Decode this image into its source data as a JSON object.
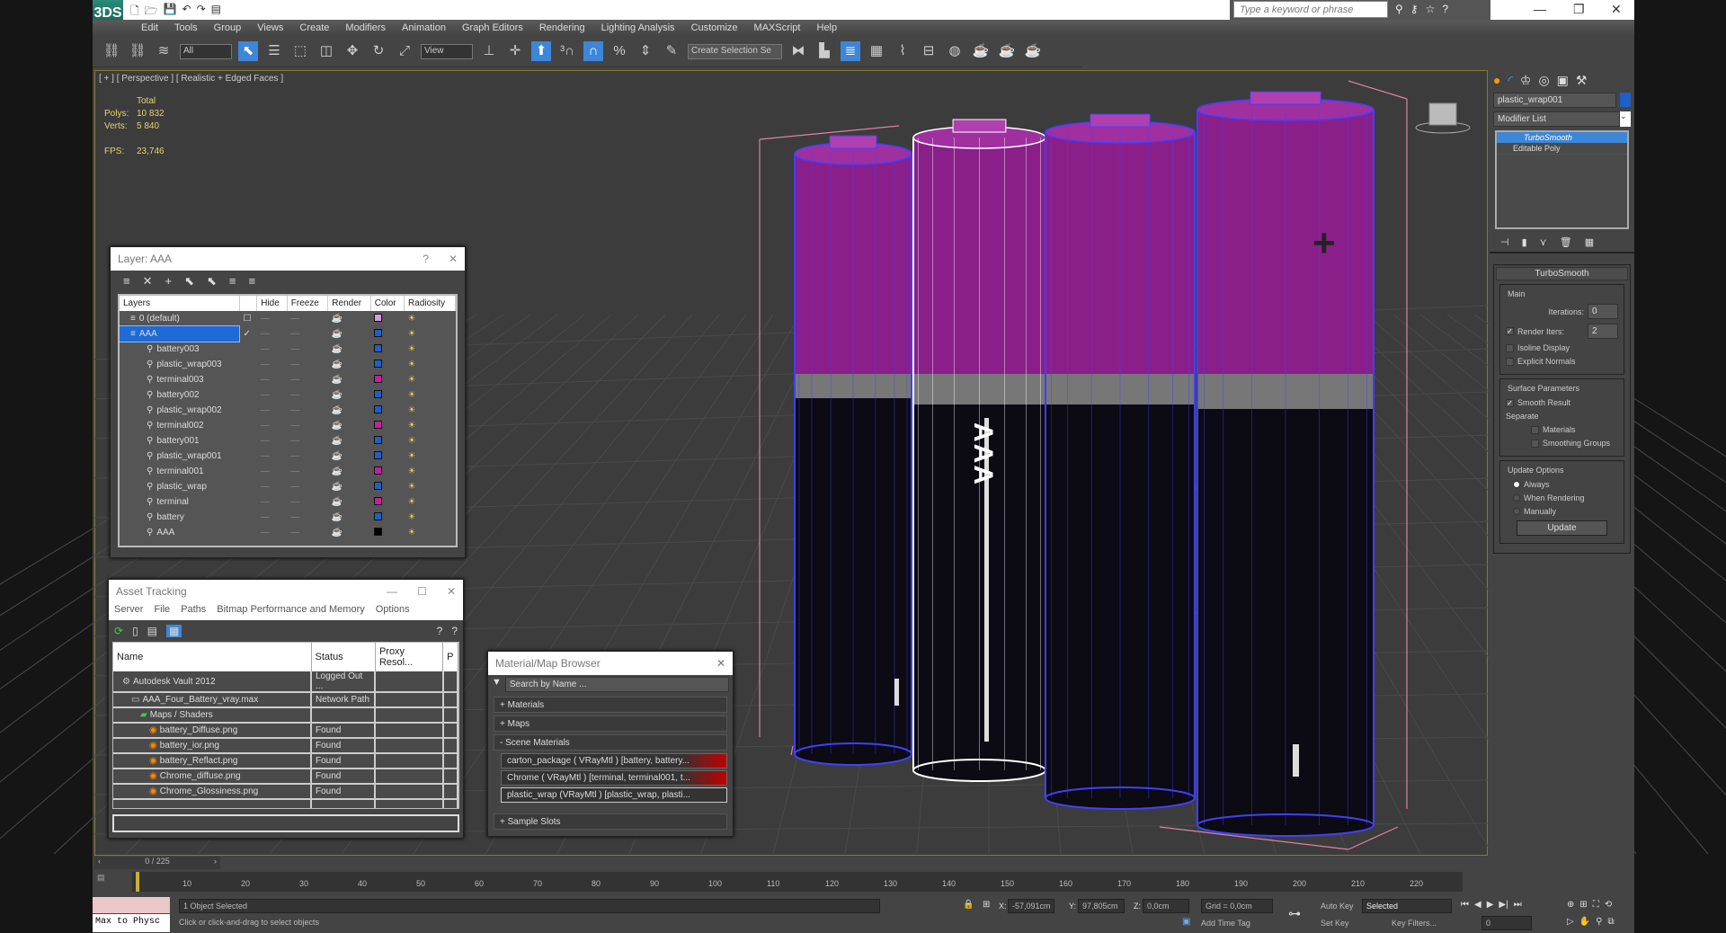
{
  "titlebar": {
    "search_placeholder": "Type a keyword or phrase",
    "logo": "3DS",
    "minimize": "—",
    "restore": "❐",
    "close": "✕"
  },
  "menu": [
    "Edit",
    "Tools",
    "Group",
    "Views",
    "Create",
    "Modifiers",
    "Animation",
    "Graph Editors",
    "Rendering",
    "Lighting Analysis",
    "Customize",
    "MAXScript",
    "Help"
  ],
  "toolbar": {
    "filter": "All",
    "ref_coord": "View",
    "selection_set": "Create Selection Se"
  },
  "viewport": {
    "label": "[ + ] [ Perspective ] [ Realistic + Edged Faces ]",
    "total_label": "Total",
    "polys_label": "Polys:",
    "polys": "10 832",
    "verts_label": "Verts:",
    "verts": "5 840",
    "fps_label": "FPS:",
    "fps": "23,746",
    "battery_text": "AAA"
  },
  "layer_dialog": {
    "title": "Layer: AAA",
    "help": "?",
    "close": "✕",
    "columns": [
      "Layers",
      "",
      "Hide",
      "Freeze",
      "Render",
      "Color",
      "Radiosity"
    ],
    "rows": [
      {
        "name": "0 (default)",
        "color": "#d79be0",
        "level": 0,
        "check": "☐"
      },
      {
        "name": "AAA",
        "color": "#1e5fc8",
        "level": 0,
        "check": "✓",
        "selected": true
      },
      {
        "name": "battery003",
        "color": "#1e5fc8",
        "level": 1
      },
      {
        "name": "plastic_wrap003",
        "color": "#1e5fc8",
        "level": 1
      },
      {
        "name": "terminal003",
        "color": "#c81ea0",
        "level": 1
      },
      {
        "name": "battery002",
        "color": "#1e5fc8",
        "level": 1
      },
      {
        "name": "plastic_wrap002",
        "color": "#1e5fc8",
        "level": 1
      },
      {
        "name": "terminal002",
        "color": "#c81ea0",
        "level": 1
      },
      {
        "name": "battery001",
        "color": "#1e5fc8",
        "level": 1
      },
      {
        "name": "plastic_wrap001",
        "color": "#1e5fc8",
        "level": 1
      },
      {
        "name": "terminal001",
        "color": "#c81ea0",
        "level": 1
      },
      {
        "name": "plastic_wrap",
        "color": "#1e5fc8",
        "level": 1
      },
      {
        "name": "terminal",
        "color": "#c81ea0",
        "level": 1
      },
      {
        "name": "battery",
        "color": "#1e5fc8",
        "level": 1
      },
      {
        "name": "AAA",
        "color": "#000000",
        "level": 1
      }
    ]
  },
  "asset_dialog": {
    "title": "Asset Tracking",
    "minimize": "—",
    "maximize": "☐",
    "close": "✕",
    "menu": [
      "Server",
      "File",
      "Paths",
      "Bitmap Performance and Memory",
      "Options"
    ],
    "columns": [
      "Name",
      "Status",
      "Proxy Resol...",
      "P"
    ],
    "rows": [
      {
        "name": "Autodesk Vault 2012",
        "status": "Logged Out ...",
        "level": 1
      },
      {
        "name": "AAA_Four_Battery_vray.max",
        "status": "Network Path",
        "level": 2
      },
      {
        "name": "Maps / Shaders",
        "status": "",
        "level": 3
      },
      {
        "name": "battery_Diffuse.png",
        "status": "Found",
        "level": 4
      },
      {
        "name": "battery_ior.png",
        "status": "Found",
        "level": 4
      },
      {
        "name": "battery_Reflact.png",
        "status": "Found",
        "level": 4
      },
      {
        "name": "Chrome_diffuse.png",
        "status": "Found",
        "level": 4
      },
      {
        "name": "Chrome_Glossiness.png",
        "status": "Found",
        "level": 4
      }
    ]
  },
  "material_browser": {
    "title": "Material/Map Browser",
    "close": "✕",
    "search_placeholder": "Search by Name ...",
    "sections": {
      "materials": "+ Materials",
      "maps": "+ Maps",
      "scene": "- Scene Materials",
      "samples": "+ Sample Slots"
    },
    "scene_materials": [
      "carton_package ( VRayMtl ) [battery, battery...",
      "Chrome  ( VRayMtl )  [terminal, terminal001, t...",
      "plastic_wrap (VRayMtl ) [plastic_wrap, plasti..."
    ]
  },
  "command_panel": {
    "object_name": "plastic_wrap001",
    "object_color": "#1e5fc8",
    "modifier_list": "Modifier List",
    "stack": [
      "TurboSmooth",
      "Editable Poly"
    ],
    "rollout": "TurboSmooth",
    "main": "Main",
    "iterations_label": "Iterations:",
    "iterations": "0",
    "render_iters_label": "Render Iters:",
    "render_iters": "2",
    "isoline": "Isoline Display",
    "explicit": "Explicit Normals",
    "surface": "Surface Parameters",
    "smooth_result": "Smooth Result",
    "separate": "Separate",
    "materials": "Materials",
    "smoothing_groups": "Smoothing Groups",
    "update_options": "Update Options",
    "always": "Always",
    "when_rendering": "When Rendering",
    "manually": "Manually",
    "update_button": "Update"
  },
  "timeline": {
    "frame": "0 / 225",
    "ticks": [
      "10",
      "20",
      "30",
      "40",
      "50",
      "60",
      "70",
      "80",
      "90",
      "100",
      "110",
      "120",
      "130",
      "140",
      "150",
      "160",
      "170",
      "180",
      "190",
      "200",
      "210",
      "220"
    ]
  },
  "status": {
    "maxscript": "Max to Physc",
    "selected": "1 Object Selected",
    "prompt": "Click or click-and-drag to select objects",
    "x_label": "X:",
    "x": "-57,091cm",
    "y_label": "Y:",
    "y": "97,805cm",
    "z_label": "Z:",
    "z": "0,0cm",
    "grid": "Grid = 0,0cm",
    "add_time_tag": "Add Time Tag",
    "auto_key": "Auto Key",
    "key_mode": "Selected",
    "set_key": "Set Key",
    "key_filters": "Key Filters...",
    "current_frame": "0"
  }
}
